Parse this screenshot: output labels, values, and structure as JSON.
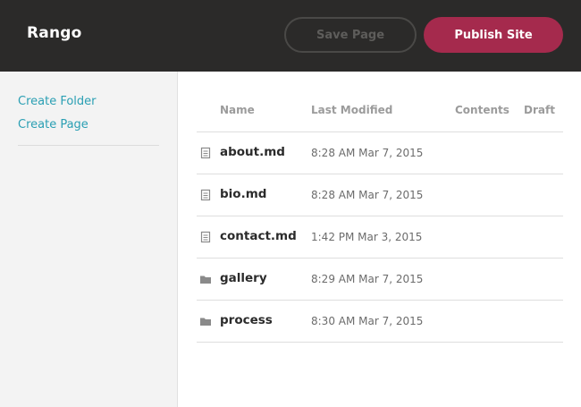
{
  "header": {
    "brand": "Rango",
    "save_label": "Save Page",
    "publish_label": "Publish Site"
  },
  "sidebar": {
    "links": [
      "Create Folder",
      "Create Page"
    ]
  },
  "table": {
    "columns": {
      "name": "Name",
      "modified": "Last Modified",
      "contents": "Contents",
      "draft": "Draft"
    },
    "rows": [
      {
        "name": "about.md",
        "modified": "8:28 AM Mar 7, 2015",
        "icon": "file-icon"
      },
      {
        "name": "bio.md",
        "modified": "8:28 AM Mar 7, 2015",
        "icon": "file-icon"
      },
      {
        "name": "contact.md",
        "modified": "1:42 PM Mar 3, 2015",
        "icon": "file-icon"
      },
      {
        "name": "gallery",
        "modified": "8:29 AM Mar 7, 2015",
        "icon": "folder-icon"
      },
      {
        "name": "process",
        "modified": "8:30 AM Mar 7, 2015",
        "icon": "folder-icon"
      }
    ]
  },
  "colors": {
    "topbar": "#2b2a29",
    "accent": "#a52a4d",
    "link": "#2a9fb3"
  }
}
